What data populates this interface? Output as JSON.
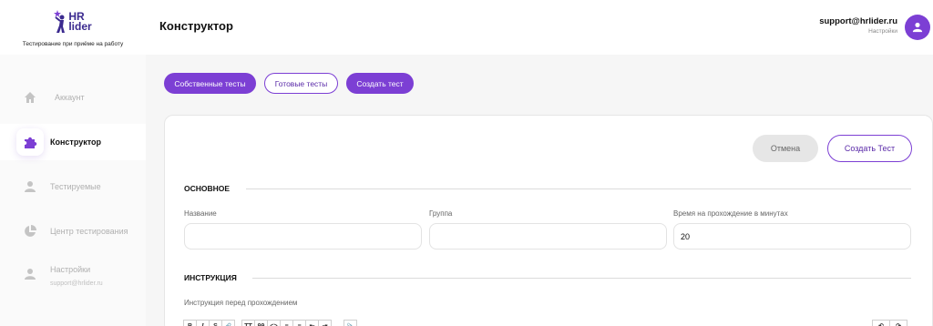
{
  "logo": {
    "line1": "HR",
    "line2": "lider",
    "tagline": "Тестирование при приёме на работу"
  },
  "sidebar": {
    "items": [
      {
        "label": "Аккаунт",
        "icon": "home-icon",
        "active": false
      },
      {
        "label": "Конструктор",
        "icon": "puzzle-icon",
        "active": true
      },
      {
        "label": "Тестируемые",
        "icon": "person-icon",
        "active": false
      },
      {
        "label": "Центр тестирования",
        "icon": "pie-chart-icon",
        "active": false
      },
      {
        "label": "Настройки",
        "sublabel": "support@hrlider.ru",
        "icon": "person-icon",
        "active": false
      }
    ]
  },
  "header": {
    "title": "Конструктор",
    "email": "support@hrlider.ru",
    "settings": "Настройки"
  },
  "tabs": [
    {
      "label": "Собственные тесты"
    },
    {
      "label": "Готовые тесты"
    },
    {
      "label": "Создать тест"
    }
  ],
  "form": {
    "cancel_label": "Отмена",
    "create_label": "Создать Тест",
    "section_main": "ОСНОВНОЕ",
    "field_name_label": "Название",
    "field_name_value": "",
    "field_group_label": "Группа",
    "field_group_value": "",
    "field_time_label": "Время на прохождение в минутах",
    "field_time_value": "20",
    "section_instruction": "ИНСТРУКЦИЯ",
    "instruction_label": "Инструкция перед прохождением"
  },
  "toolbar": {
    "bold": "B",
    "italic": "I",
    "strike": "S",
    "link": "🔗",
    "heading": "TT",
    "quote": "99",
    "code": "<>",
    "bullets": "≡",
    "numbers": "≡",
    "outdent": "⇤",
    "indent": "⇥",
    "attach": "📎",
    "undo": "↶",
    "redo": "↷"
  },
  "colors": {
    "accent": "#7c3fd4",
    "logo": "#3b2a8f"
  }
}
